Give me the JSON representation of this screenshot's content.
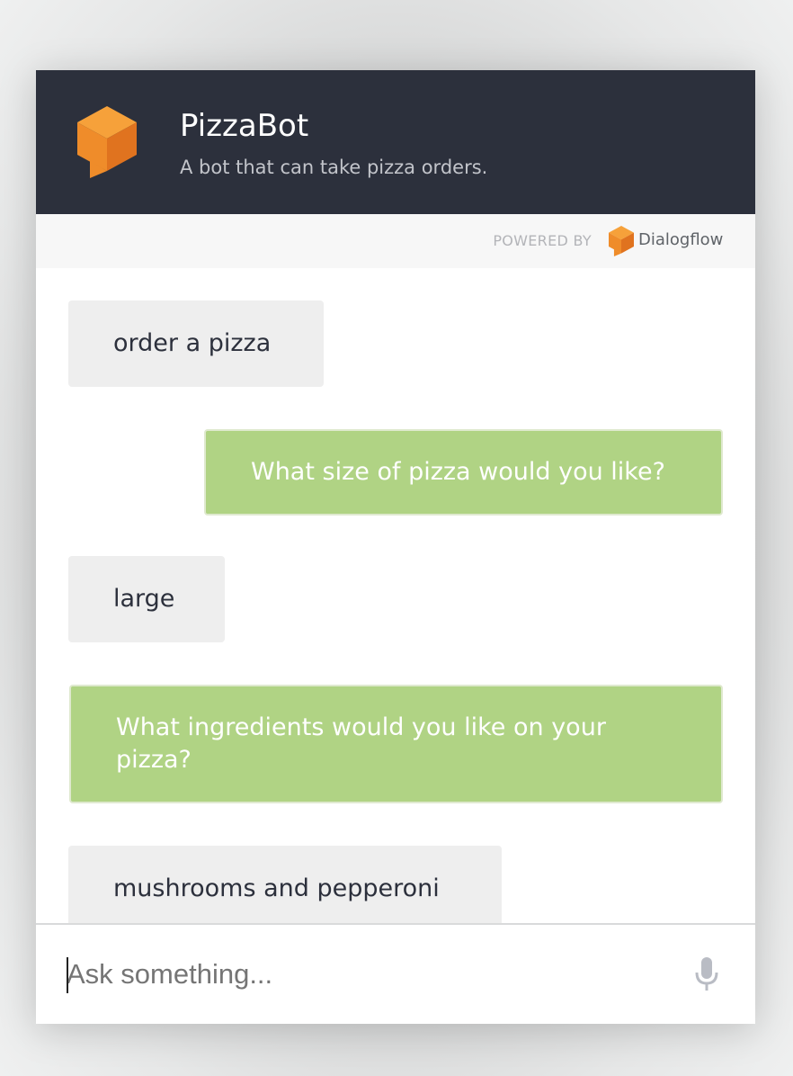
{
  "header": {
    "title": "PizzaBot",
    "subtitle": "A bot that can take pizza orders.",
    "logo_icon": "dialogflow-cube-icon",
    "background": "#2c303c"
  },
  "powered_by": {
    "label": "POWERED BY",
    "brand": "Dialogflow",
    "brand_icon": "dialogflow-cube-icon"
  },
  "messages": [
    {
      "sender": "user",
      "text": "order a pizza"
    },
    {
      "sender": "bot",
      "text": "What size of pizza would you like?"
    },
    {
      "sender": "user",
      "text": "large"
    },
    {
      "sender": "bot",
      "text": "What ingredients would you like on your pizza?"
    },
    {
      "sender": "user",
      "text": "mushrooms and pepperoni"
    }
  ],
  "input": {
    "placeholder": "Ask something...",
    "value": "",
    "mic_icon": "microphone-icon"
  },
  "colors": {
    "brand_orange": "#f39c33",
    "bot_bubble": "#b0d384",
    "user_bubble": "#eeeeee"
  }
}
